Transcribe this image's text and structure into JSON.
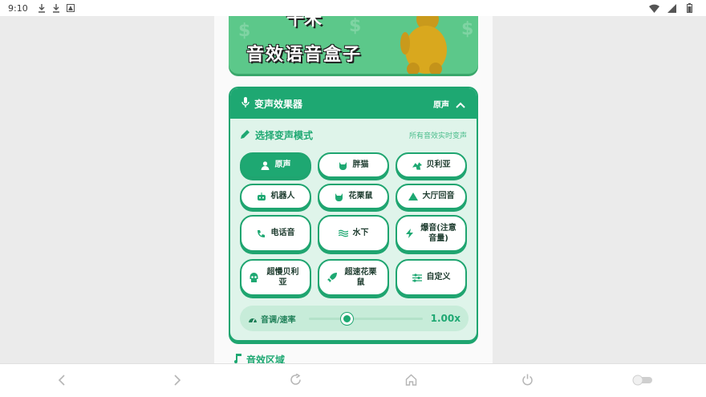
{
  "status_bar": {
    "time": "9:10"
  },
  "banner": {
    "title": "音效语音盒子",
    "title_partial": "千禾"
  },
  "voice_changer": {
    "title": "变声效果器",
    "current_mode": "原声",
    "section_label": "选择变声模式",
    "hint": "所有音效实时变声",
    "modes": [
      {
        "label": "原声",
        "icon": "person-icon",
        "active": true
      },
      {
        "label": "胖猫",
        "icon": "cat-icon",
        "active": false
      },
      {
        "label": "贝利亚",
        "icon": "dragon-icon",
        "active": false
      },
      {
        "label": "机器人",
        "icon": "robot-icon",
        "active": false
      },
      {
        "label": "花栗鼠",
        "icon": "squirrel-icon",
        "active": false
      },
      {
        "label": "大厅回音",
        "icon": "mountain-icon",
        "active": false
      },
      {
        "label": "电话音",
        "icon": "phone-icon",
        "active": false
      },
      {
        "label": "水下",
        "icon": "water-icon",
        "active": false
      },
      {
        "label": "爆音(注意音量)",
        "icon": "bolt-icon",
        "active": false
      },
      {
        "label": "超慢贝利亚",
        "icon": "skull-icon",
        "active": false
      },
      {
        "label": "超速花栗鼠",
        "icon": "rocket-icon",
        "active": false
      },
      {
        "label": "自定义",
        "icon": "sliders-icon",
        "active": false
      }
    ],
    "pitch": {
      "label": "音调/速率",
      "value_text": "1.00x",
      "fraction": 0.33
    }
  },
  "next_section": {
    "label": "音效区域"
  },
  "colors": {
    "accent": "#1ea872",
    "card_bg": "#dff4ea",
    "banner": "#5cc88a"
  }
}
